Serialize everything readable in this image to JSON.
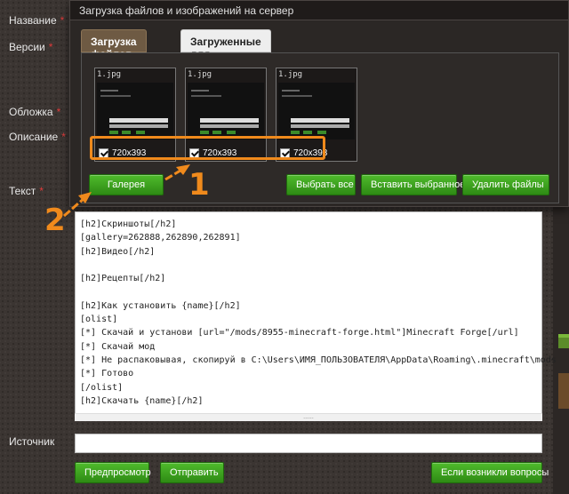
{
  "labels": {
    "name": "Название",
    "versions": "Версии",
    "cover": "Обложка",
    "description": "Описание",
    "text": "Текст",
    "source": "Источник",
    "required_mark": "*"
  },
  "modal": {
    "title": "Загрузка файлов и изображений на сервер",
    "tabs": [
      {
        "label": "Загрузка файлов",
        "active": true
      },
      {
        "label": "Загруженные для публикации",
        "active": false
      }
    ],
    "thumbnails": [
      {
        "name": "1.jpg",
        "checked": true,
        "size": "720x393"
      },
      {
        "name": "1.jpg",
        "checked": true,
        "size": "720x393"
      },
      {
        "name": "1.jpg",
        "checked": true,
        "size": "720x393"
      }
    ],
    "buttons": {
      "gallery": "Галерея",
      "select_all": "Выбрать все",
      "insert_selected": "Вставить выбранное",
      "delete_files": "Удалить файлы"
    }
  },
  "annotations": {
    "step1": "1",
    "step2": "2",
    "color": "#f08a1c"
  },
  "editor": {
    "lines": [
      "[h2]Скриншоты[/h2]",
      "[gallery=262888,262890,262891]",
      "[h2]Видео[/h2]",
      "",
      "[h2]Рецепты[/h2]",
      "",
      "[h2]Как установить {name}[/h2]",
      "[olist]",
      "[*] Скачай и установи [url=\"/mods/8955-minecraft-forge.html\"]Minecraft Forge[/url]",
      "[*] Скачай мод",
      "[*] Не распаковывая, скопируй в C:\\Users\\ИМЯ_ПОЛЬЗОВАТЕЛЯ\\AppData\\Roaming\\.minecraft\\mods",
      "[*] Готово",
      "[/olist]",
      "[h2]Скачать {name}[/h2]"
    ],
    "resize_handle": "......"
  },
  "source": {
    "value": ""
  },
  "buttons": {
    "preview": "Предпросмотр",
    "submit": "Отправить",
    "questions": "Если возникли вопросы"
  },
  "colors": {
    "accent_green": "#3a9a1e",
    "annotation_orange": "#f08a1c",
    "tab_active": "#6e5a43"
  }
}
